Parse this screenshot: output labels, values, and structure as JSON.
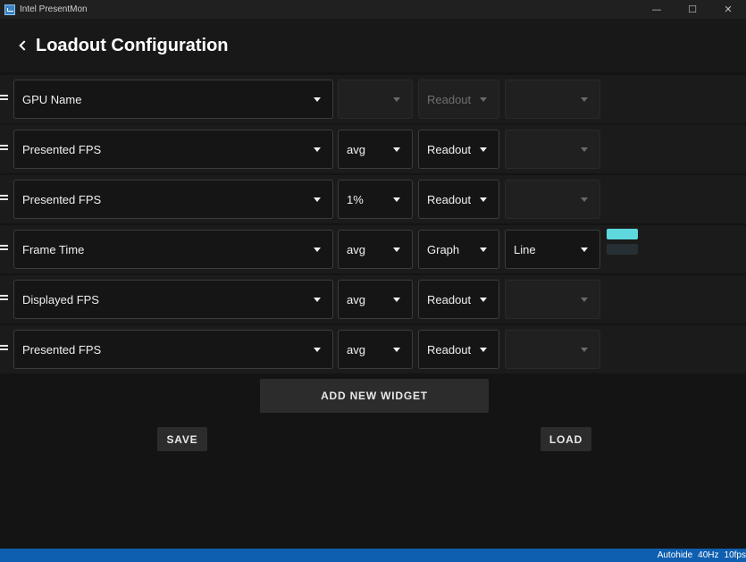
{
  "window": {
    "title": "Intel PresentMon",
    "minimize_glyph": "—",
    "maximize_glyph": "☐",
    "close_glyph": "✕"
  },
  "header": {
    "title": "Loadout Configuration"
  },
  "colors": {
    "accent_cyan": "#5ed8dc",
    "swatch_dark": "#263034",
    "statusbar": "#0f5fb0"
  },
  "widgets": [
    {
      "metric": "GPU Name",
      "stat": "",
      "type": "Readout",
      "style": "",
      "stat_enabled": false,
      "type_enabled": false,
      "style_enabled": false
    },
    {
      "metric": "Presented FPS",
      "stat": "avg",
      "type": "Readout",
      "style": "",
      "stat_enabled": true,
      "type_enabled": true,
      "style_enabled": false
    },
    {
      "metric": "Presented FPS",
      "stat": "1%",
      "type": "Readout",
      "style": "",
      "stat_enabled": true,
      "type_enabled": true,
      "style_enabled": false
    },
    {
      "metric": "Frame Time",
      "stat": "avg",
      "type": "Graph",
      "style": "Line",
      "stat_enabled": true,
      "type_enabled": true,
      "style_enabled": true,
      "line_colors": [
        "#5ed8dc",
        "#263034"
      ]
    },
    {
      "metric": "Displayed FPS",
      "stat": "avg",
      "type": "Readout",
      "style": "",
      "stat_enabled": true,
      "type_enabled": true,
      "style_enabled": false
    },
    {
      "metric": "Presented FPS",
      "stat": "avg",
      "type": "Readout",
      "style": "",
      "stat_enabled": true,
      "type_enabled": true,
      "style_enabled": false
    }
  ],
  "actions": {
    "add_widget_label": "ADD NEW WIDGET",
    "save_label": "SAVE",
    "load_label": "LOAD"
  },
  "statusbar": {
    "autohide": "Autohide",
    "refresh_rate": "40Hz",
    "fps": "10fps"
  }
}
